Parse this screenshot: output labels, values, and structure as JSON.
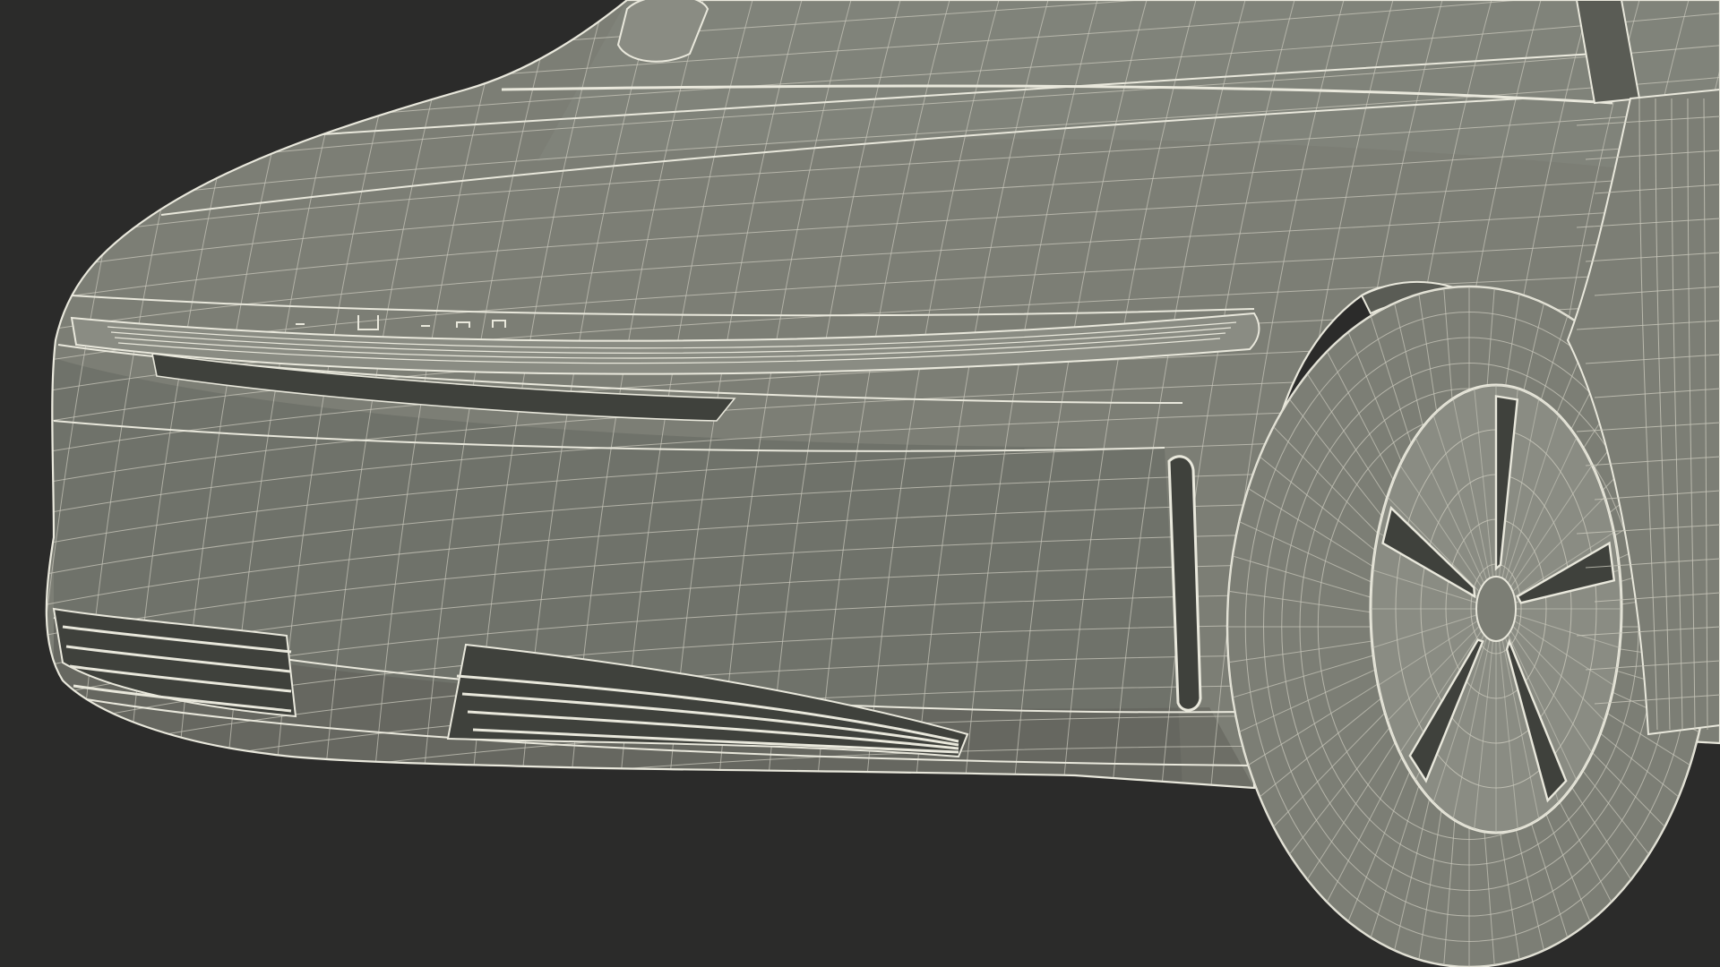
{
  "scene": {
    "subject": "car-front-wireframe-render",
    "colors": {
      "background": "#2b2b2a",
      "surface": "#7c7e75",
      "surface_light": "#8a8c83",
      "surface_dark": "#5a5c55",
      "wire": "#e9e8dc",
      "wire_dim": "#c9c8bc",
      "cavity": "#3f413c"
    },
    "badge_icons": [
      "dash-glyph-icon",
      "u-glyph-icon",
      "slash-glyph-icon",
      "ridge-glyph-icon",
      "ridge-glyph-icon"
    ],
    "wheel_spokes": 5
  }
}
